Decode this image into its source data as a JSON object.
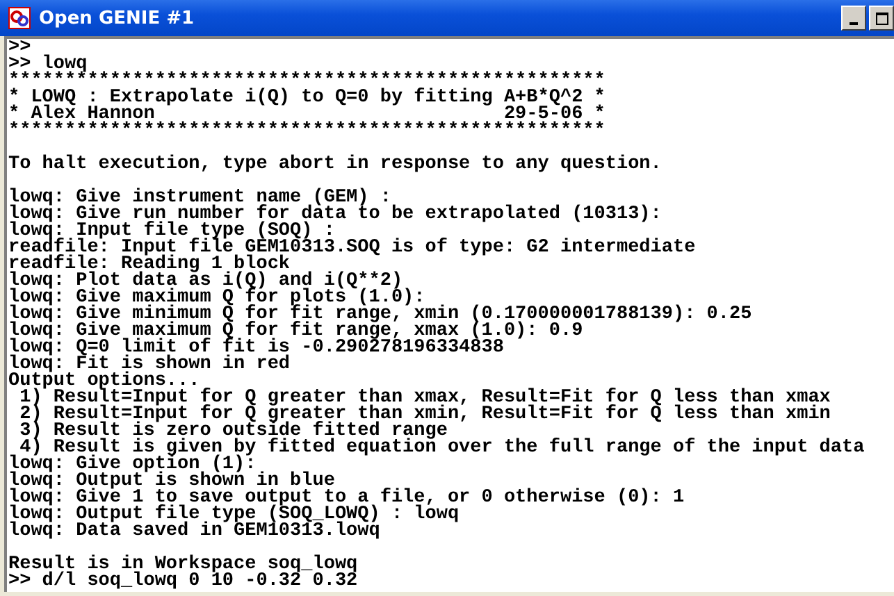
{
  "window": {
    "title": "Open GENIE #1"
  },
  "console": {
    "blocks": [
      [
        ">>",
        ">> lowq",
        "*****************************************************",
        "* LOWQ : Extrapolate i(Q) to Q=0 by fitting A+B*Q^2 *",
        "* Alex Hannon                               29-5-06 *",
        "*****************************************************"
      ],
      [
        "To halt execution, type abort in response to any question."
      ],
      [
        "lowq: Give instrument name (GEM) :",
        "lowq: Give run number for data to be extrapolated (10313):",
        "lowq: Input file type (SOQ) :",
        "readfile: Input file GEM10313.SOQ is of type: G2 intermediate",
        "readfile: Reading 1 block",
        "lowq: Plot data as i(Q) and i(Q**2)",
        "lowq: Give maximum Q for plots (1.0):",
        "lowq: Give minimum Q for fit range, xmin (0.170000001788139): 0.25",
        "lowq: Give maximum Q for fit range, xmax (1.0): 0.9",
        "lowq: Q=0 limit of fit is -0.290278196334838",
        "lowq: Fit is shown in red",
        "Output options...",
        " 1) Result=Input for Q greater than xmax, Result=Fit for Q less than xmax",
        " 2) Result=Input for Q greater than xmin, Result=Fit for Q less than xmin",
        " 3) Result is zero outside fitted range",
        " 4) Result is given by fitted equation over the full range of the input data",
        "lowq: Give option (1):",
        "lowq: Output is shown in blue",
        "lowq: Give 1 to save output to a file, or 0 otherwise (0): 1",
        "lowq: Output file type (SOQ_LOWQ) : lowq",
        "lowq: Data saved in GEM10313.lowq"
      ],
      [
        "Result is in Workspace soq_lowq",
        ">> d/l soq_lowq 0 10 -0.32 0.32"
      ]
    ]
  }
}
